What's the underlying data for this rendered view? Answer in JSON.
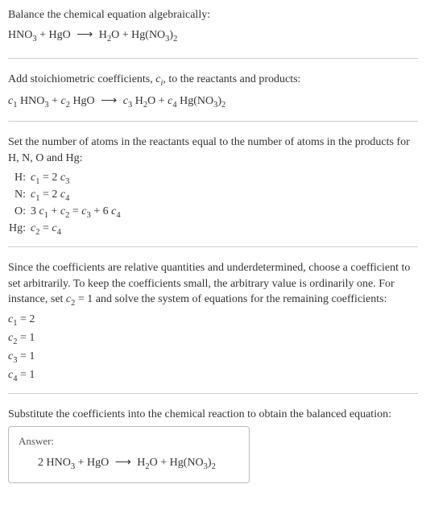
{
  "intro": {
    "title": "Balance the chemical equation algebraically:",
    "eq_lhs1": "HNO",
    "eq_lhs1_sub": "3",
    "eq_plus1": " + HgO  ",
    "arrow": "⟶",
    "eq_rhs1": "  H",
    "eq_rhs1_sub": "2",
    "eq_rhs2": "O + Hg(NO",
    "eq_rhs2_sub": "3",
    "eq_rhs3": ")",
    "eq_rhs3_sub": "2"
  },
  "stoich": {
    "title_a": "Add stoichiometric coefficients, ",
    "ci": "c",
    "ci_sub": "i",
    "title_b": ", to the reactants and products:",
    "c1": "c",
    "c1s": "1",
    "r1": " HNO",
    "r1s": "3",
    "plus1": " + ",
    "c2": "c",
    "c2s": "2",
    "r2": " HgO  ",
    "arrow": "⟶",
    "sp": "  ",
    "c3": "c",
    "c3s": "3",
    "r3": " H",
    "r3s": "2",
    "r3b": "O + ",
    "c4": "c",
    "c4s": "4",
    "r4": " Hg(NO",
    "r4s": "3",
    "r4b": ")",
    "r4bs": "2"
  },
  "atoms": {
    "title": "Set the number of atoms in the reactants equal to the number of atoms in the products for H, N, O and Hg:",
    "rows": {
      "H": {
        "label": "H:",
        "c1": "c",
        "c1s": "1",
        "mid": " = 2 ",
        "c3": "c",
        "c3s": "3"
      },
      "N": {
        "label": "N:",
        "c1": "c",
        "c1s": "1",
        "mid": " = 2 ",
        "c4": "c",
        "c4s": "4"
      },
      "O": {
        "label": "O:",
        "a": "3 ",
        "c1": "c",
        "c1s": "1",
        "p": " + ",
        "c2": "c",
        "c2s": "2",
        "eq": " = ",
        "c3": "c",
        "c3s": "3",
        "p2": " + 6 ",
        "c4": "c",
        "c4s": "4"
      },
      "Hg": {
        "label": "Hg:",
        "c2": "c",
        "c2s": "2",
        "mid": " = ",
        "c4": "c",
        "c4s": "4"
      }
    }
  },
  "choose": {
    "text_a": "Since the coefficients are relative quantities and underdetermined, choose a coefficient to set arbitrarily. To keep the coefficients small, the arbitrary value is ordinarily one. For instance, set ",
    "c2": "c",
    "c2s": "2",
    "text_b": " = 1 and solve the system of equations for the remaining coefficients:",
    "coefs": {
      "r1": {
        "c": "c",
        "s": "1",
        "v": " = 2"
      },
      "r2": {
        "c": "c",
        "s": "2",
        "v": " = 1"
      },
      "r3": {
        "c": "c",
        "s": "3",
        "v": " = 1"
      },
      "r4": {
        "c": "c",
        "s": "4",
        "v": " = 1"
      }
    }
  },
  "subst": {
    "text": "Substitute the coefficients into the chemical reaction to obtain the balanced equation:"
  },
  "answer": {
    "label": "Answer:",
    "a": "2 HNO",
    "as": "3",
    "b": " + HgO  ",
    "arrow": "⟶",
    "c": "  H",
    "cs": "2",
    "d": "O + Hg(NO",
    "ds": "3",
    "e": ")",
    "es": "2"
  }
}
